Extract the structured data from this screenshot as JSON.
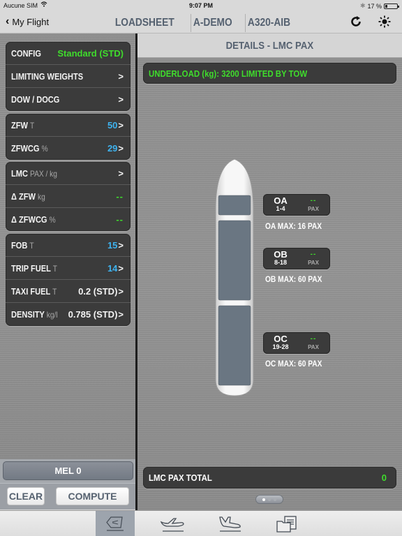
{
  "status_bar": {
    "carrier": "Aucune SIM",
    "time": "9:07 PM",
    "battery_percent": "17 %",
    "battery_level": 0.17
  },
  "nav": {
    "back_label": "My Flight",
    "title_segments": [
      "LOADSHEET",
      "A-DEMO",
      "A320-AIB"
    ],
    "refresh_icon": "refresh-icon",
    "brightness_icon": "brightness-icon"
  },
  "left_panel": {
    "group1": [
      {
        "label": "CONFIG",
        "unit": "",
        "value": "Standard (STD)",
        "value_color": "green",
        "arrow": ""
      },
      {
        "label": "LIMITING WEIGHTS",
        "unit": "",
        "value": "",
        "value_color": "white",
        "arrow": ">"
      },
      {
        "label": "DOW / DOCG",
        "unit": "",
        "value": "",
        "value_color": "white",
        "arrow": ">"
      }
    ],
    "group2": [
      {
        "label": "ZFW",
        "unit": "T",
        "value": "50",
        "value_color": "blue",
        "arrow": ">"
      },
      {
        "label": "ZFWCG",
        "unit": "%",
        "value": "29",
        "value_color": "blue",
        "arrow": ">"
      }
    ],
    "group3": [
      {
        "label": "LMC",
        "unit": "PAX / kg",
        "value": "",
        "value_color": "white",
        "arrow": ">"
      },
      {
        "label": "Δ ZFW",
        "unit": "kg",
        "value": "--",
        "value_color": "green",
        "arrow": ""
      },
      {
        "label": "Δ ZFWCG",
        "unit": "%",
        "value": "--",
        "value_color": "green",
        "arrow": ""
      }
    ],
    "group4": [
      {
        "label": "FOB",
        "unit": "T",
        "value": "15",
        "value_color": "blue",
        "arrow": ">"
      },
      {
        "label": "TRIP FUEL",
        "unit": "T",
        "value": "14",
        "value_color": "blue",
        "arrow": ">"
      },
      {
        "label": "TAXI FUEL",
        "unit": "T",
        "value": "0.2 (STD)",
        "value_color": "white",
        "arrow": ">"
      },
      {
        "label": "DENSITY",
        "unit": "kg/l",
        "value": "0.785 (STD)",
        "value_color": "white",
        "arrow": ">"
      }
    ],
    "mel_label": "MEL 0",
    "clear_label": "CLEAR",
    "compute_label": "COMPUTE"
  },
  "right_panel": {
    "header": "DETAILS - LMC PAX",
    "underload": "UNDERLOAD (kg): 3200 LIMITED BY TOW",
    "zones": [
      {
        "name": "OA",
        "rows": "1-4",
        "value": "--",
        "unit": "PAX",
        "max": "OA MAX: 16 PAX"
      },
      {
        "name": "OB",
        "rows": "8-18",
        "value": "--",
        "unit": "PAX",
        "max": "OB MAX: 60 PAX"
      },
      {
        "name": "OC",
        "rows": "19-28",
        "value": "--",
        "unit": "PAX",
        "max": "OC MAX: 60 PAX"
      }
    ],
    "total_label": "LMC PAX TOTAL",
    "total_value": "0",
    "page_count": 3,
    "page_active": 1
  },
  "tab_bar": {
    "tabs": [
      {
        "icon": "loadsheet-icon",
        "active": true
      },
      {
        "icon": "takeoff-icon",
        "active": false
      },
      {
        "icon": "landing-icon",
        "active": false
      },
      {
        "icon": "documents-icon",
        "active": false
      }
    ]
  },
  "colors": {
    "green": "#3fdc2c",
    "blue": "#3eb3f0",
    "title_slate": "#556170",
    "panel_dark": "#3b3b3b"
  }
}
